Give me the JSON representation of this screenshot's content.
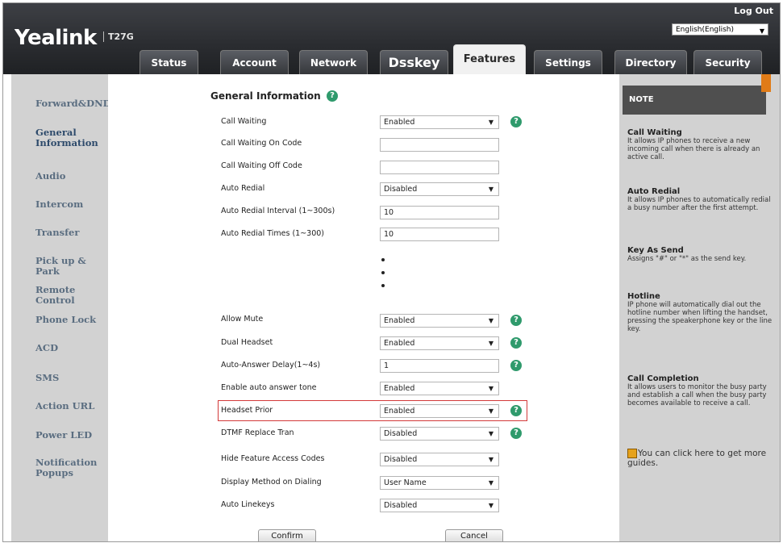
{
  "header": {
    "logo": "Yealink",
    "model": "T27G",
    "logout": "Log Out",
    "language": "English(English)"
  },
  "tabs": [
    {
      "label": "Status"
    },
    {
      "label": "Account"
    },
    {
      "label": "Network"
    },
    {
      "label": "Dsskey"
    },
    {
      "label": "Features"
    },
    {
      "label": "Settings"
    },
    {
      "label": "Directory"
    },
    {
      "label": "Security"
    }
  ],
  "sidebar": {
    "items": [
      {
        "label": "Forward&DND"
      },
      {
        "label": "General Information"
      },
      {
        "label": "Audio"
      },
      {
        "label": "Intercom"
      },
      {
        "label": "Transfer"
      },
      {
        "label": "Pick up & Park"
      },
      {
        "label": "Remote Control"
      },
      {
        "label": "Phone Lock"
      },
      {
        "label": "ACD"
      },
      {
        "label": "SMS"
      },
      {
        "label": "Action URL"
      },
      {
        "label": "Power LED"
      },
      {
        "label": "Notification Popups"
      }
    ]
  },
  "main": {
    "section_title": "General Information",
    "rows": [
      {
        "label": "Call Waiting",
        "value": "Enabled"
      },
      {
        "label": "Call Waiting On Code",
        "value": ""
      },
      {
        "label": "Call Waiting Off Code",
        "value": ""
      },
      {
        "label": "Auto Redial",
        "value": "Disabled"
      },
      {
        "label": "Auto Redial Interval (1~300s)",
        "value": "10"
      },
      {
        "label": "Auto Redial Times (1~300)",
        "value": "10"
      },
      {
        "label": "Allow Mute",
        "value": "Enabled"
      },
      {
        "label": "Dual Headset",
        "value": "Enabled"
      },
      {
        "label": "Auto-Answer Delay(1~4s)",
        "value": "1"
      },
      {
        "label": "Enable auto answer tone",
        "value": "Enabled"
      },
      {
        "label": "Headset Prior",
        "value": "Enabled"
      },
      {
        "label": "DTMF Replace Tran",
        "value": "Disabled"
      },
      {
        "label": "Hide Feature Access Codes",
        "value": "Disabled"
      },
      {
        "label": "Display Method on Dialing",
        "value": "User Name"
      },
      {
        "label": "Auto Linekeys",
        "value": "Disabled"
      }
    ],
    "confirm_label": "Confirm",
    "cancel_label": "Cancel"
  },
  "note": {
    "title": "NOTE",
    "entries": [
      {
        "title": "Call Waiting",
        "text": "It allows IP phones to receive a new incoming call when there is already an active call."
      },
      {
        "title": "Auto Redial",
        "text": "It allows IP phones to automatically redial a busy number after the first attempt."
      },
      {
        "title": "Key As Send",
        "text": "Assigns \"#\" or \"*\" as the send key."
      },
      {
        "title": "Hotline",
        "text": "IP phone will automatically dial out the hotline number when lifting the handset, pressing the speakerphone key or the line key."
      },
      {
        "title": "Call Completion",
        "text": "It allows users to monitor the busy party and establish a call when the busy party becomes available to receive a call."
      }
    ],
    "guide": "You can click here to get more guides."
  },
  "colors": {
    "accent_orange": "#e07b17",
    "help_green": "#2f9a6c",
    "highlight_red": "#d33a3a"
  }
}
